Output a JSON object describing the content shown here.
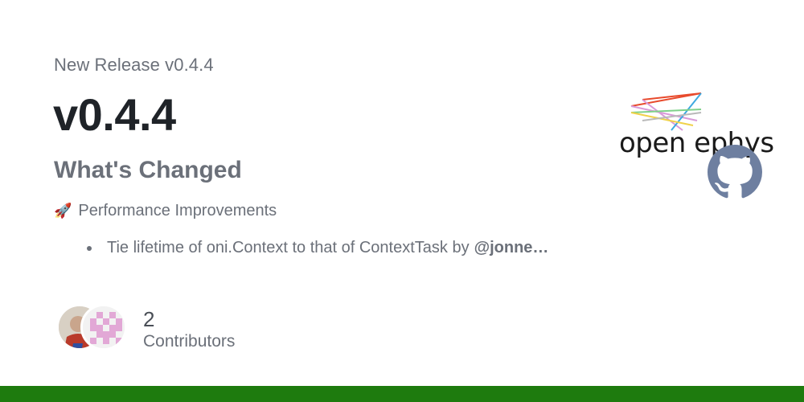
{
  "header": {
    "label": "New Release v0.4.4",
    "title": "v0.4.4"
  },
  "body": {
    "section_heading": "What's Changed",
    "subheading": "Performance Improvements",
    "subheading_icon": "rocket-icon",
    "items": [
      {
        "text": "Tie lifetime of oni.Context to that of ContextTask by",
        "author": "@jonne…"
      }
    ]
  },
  "contributors": {
    "count": "2",
    "label": "Contributors"
  },
  "brand": {
    "logo_text": "open ephys",
    "repo_icon": "github-icon"
  },
  "colors": {
    "footer_bar": "#1e7b0e",
    "title": "#1f2328",
    "muted": "#6b7079"
  }
}
